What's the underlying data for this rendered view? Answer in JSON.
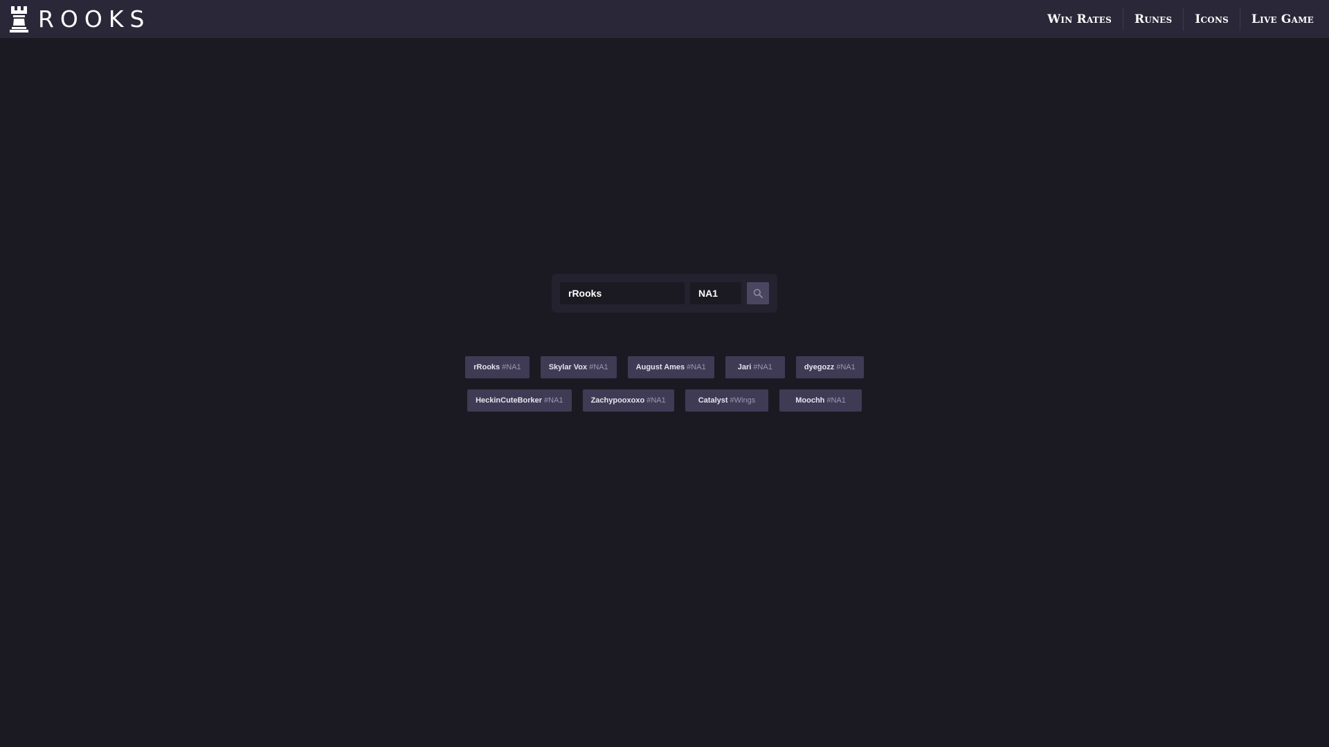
{
  "header": {
    "brand_name": "ROOKS",
    "brand_icon": "rook-chess-icon",
    "nav": [
      {
        "label": "Win Rates"
      },
      {
        "label": "Runes"
      },
      {
        "label": "Icons"
      },
      {
        "label": "Live Game"
      }
    ]
  },
  "search": {
    "name_value": "rRooks",
    "tag_value": "NA1",
    "button_icon": "search-icon"
  },
  "recent": {
    "row1": [
      {
        "name": "rRooks",
        "tag": "#NA1"
      },
      {
        "name": "Skylar Vox",
        "tag": "#NA1"
      },
      {
        "name": "August Ames",
        "tag": "#NA1"
      },
      {
        "name": "Jari",
        "tag": "#NA1"
      },
      {
        "name": "dyegozz",
        "tag": "#NA1"
      }
    ],
    "row2": [
      {
        "name": "HeckinCuteBorker",
        "tag": "#NA1"
      },
      {
        "name": "Zachypooxoxo",
        "tag": "#NA1"
      },
      {
        "name": "Catalyst",
        "tag": "#Wings"
      },
      {
        "name": "Moochh",
        "tag": "#NA1"
      }
    ]
  },
  "colors": {
    "background": "#1b1a22",
    "topbar": "#2a2838",
    "chip": "#3f3b55",
    "search_button": "#4a4660"
  }
}
